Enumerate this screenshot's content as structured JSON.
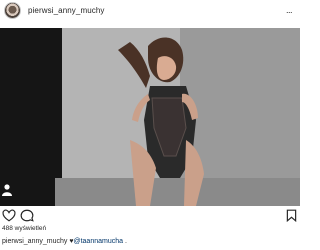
{
  "header": {
    "username": "pierwsi_anny_muchy",
    "more": "..."
  },
  "post": {
    "views_label": "488 wyświetleń"
  },
  "caption": {
    "username": "pierwsi_anny_muchy",
    "heart": "♥",
    "mention": "@taannamucha",
    "tail": " ."
  },
  "icons": [
    "avatar",
    "more-icon",
    "heart-icon",
    "comment-icon",
    "bookmark-icon",
    "video-camera-icon"
  ]
}
